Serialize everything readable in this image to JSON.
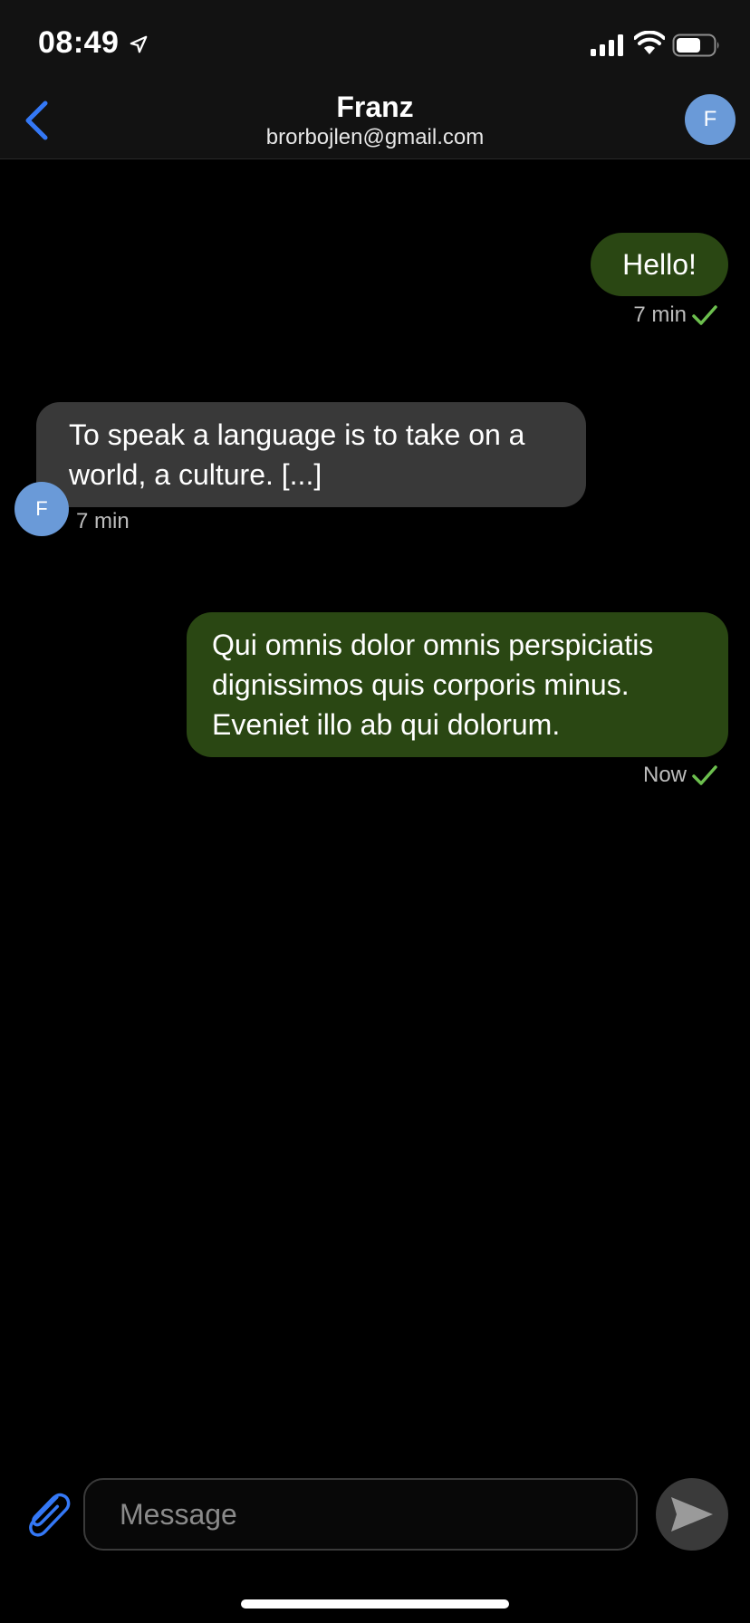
{
  "status_bar": {
    "time": "08:49",
    "icons": [
      "location-arrow-icon",
      "cellular-signal-icon",
      "wifi-icon",
      "battery-icon"
    ]
  },
  "header": {
    "back_icon": "chevron-left-icon",
    "title": "Franz",
    "subtitle": "brorbojlen@gmail.com",
    "avatar_initial": "F"
  },
  "messages": [
    {
      "direction": "outgoing",
      "text": "Hello!",
      "time": "7 min",
      "status_icon": "check-icon"
    },
    {
      "direction": "incoming",
      "text": "To speak a language is to take on a world, a culture. [...]",
      "time": "7 min",
      "avatar_initial": "F"
    },
    {
      "direction": "outgoing",
      "text": "Qui omnis dolor omnis perspiciatis dignissimos quis corporis minus. Eveniet illo ab qui dolorum.",
      "time": "Now",
      "status_icon": "check-icon"
    }
  ],
  "composer": {
    "attach_icon": "paperclip-icon",
    "placeholder": "Message",
    "value": "",
    "send_icon": "send-icon"
  },
  "colors": {
    "accent": "#3478f6",
    "outgoing_bubble": "#2a4713",
    "incoming_bubble": "#393939",
    "avatar": "#6a9ad8",
    "check": "#6cbf4e"
  }
}
